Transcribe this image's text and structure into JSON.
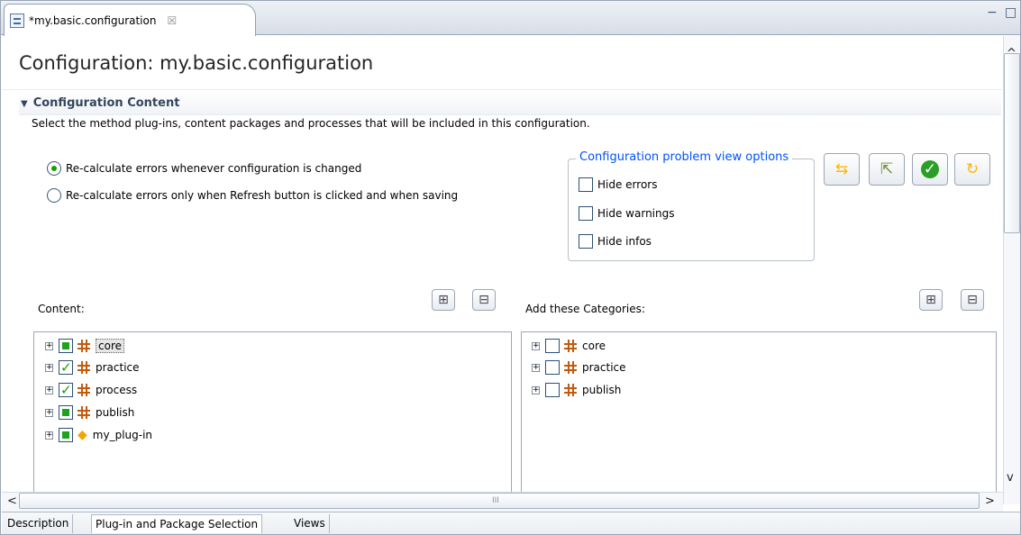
{
  "editor": {
    "tab_label": "*my.basic.configuration",
    "close": "☒",
    "minimize": "−",
    "maximize": "□"
  },
  "form": {
    "title": "Configuration: my.basic.configuration",
    "section_title": "Configuration Content",
    "description": "Select the method plug-ins, content packages and processes that will be included in this configuration."
  },
  "options": {
    "radio_1": "Re-calculate errors whenever configuration is changed",
    "radio_2": "Re-calculate errors only when Refresh button is clicked and when saving",
    "group_title": "Configuration problem view options",
    "checks": [
      "Hide errors",
      "Hide warnings",
      "Hide infos"
    ]
  },
  "toolbar": {
    "swap": "⇆",
    "export": "⇱",
    "validate": "✓",
    "refresh": "↻"
  },
  "left": {
    "label": "Content:",
    "expand": "⊞",
    "collapse": "⊟",
    "items": [
      "core",
      "practice",
      "process",
      "publish",
      "my_plug-in"
    ]
  },
  "right": {
    "label": "Add these Categories:",
    "expand": "⊞",
    "collapse": "⊟",
    "items": [
      "core",
      "practice",
      "publish"
    ]
  },
  "scroll": {
    "left": "<",
    "right": ">",
    "up": "^",
    "down": "v",
    "grip": "III"
  },
  "bottom_tabs": [
    "Description",
    "Plug-in and Package Selection",
    "Views"
  ],
  "colors": {
    "accent": "#0051ff",
    "check": "#16a000",
    "package": "#c25b10"
  }
}
